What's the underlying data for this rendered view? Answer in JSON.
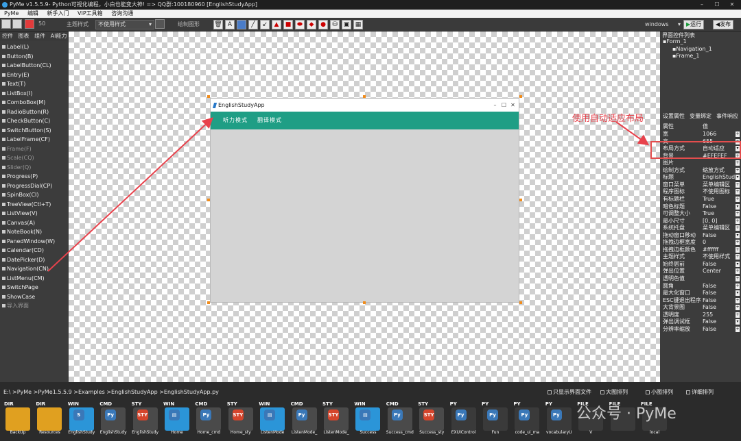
{
  "window": {
    "title": "PyMe v1.5.5.9- Python可视化编程，小白也能变大神!  => QQ群:100180960   [EnglishStudyApp]"
  },
  "menu": [
    "PyMe",
    "编辑",
    "新手入门",
    "VIP工具箱",
    "咨询沟通"
  ],
  "toolbar": {
    "zoom": "50",
    "theme_label": "主题样式",
    "theme_value": "不使用样式",
    "draw_label": "绘制图形",
    "platform": "windows",
    "run_label": "运行",
    "publish_label": "发布"
  },
  "left_tabs": [
    "控件",
    "图表",
    "组件",
    "AI能力"
  ],
  "widgets": [
    {
      "label": "Label(L)",
      "dim": false
    },
    {
      "label": "Button(B)",
      "dim": false
    },
    {
      "label": "LabelButton(CL)",
      "dim": false
    },
    {
      "label": "Entry(E)",
      "dim": false
    },
    {
      "label": "Text(T)",
      "dim": false
    },
    {
      "label": "ListBox(I)",
      "dim": false
    },
    {
      "label": "ComboBox(M)",
      "dim": false
    },
    {
      "label": "RadioButton(R)",
      "dim": false
    },
    {
      "label": "CheckButton(C)",
      "dim": false
    },
    {
      "label": "SwitchButton(S)",
      "dim": false
    },
    {
      "label": "LabelFrame(CF)",
      "dim": false
    },
    {
      "label": "Frame(F)",
      "dim": true
    },
    {
      "label": "Scale(CQ)",
      "dim": true
    },
    {
      "label": "Slider(Q)",
      "dim": true
    },
    {
      "label": "Progress(P)",
      "dim": false
    },
    {
      "label": "ProgressDial(CP)",
      "dim": false
    },
    {
      "label": "SpinBox(CI)",
      "dim": false
    },
    {
      "label": "TreeView(Ctl+T)",
      "dim": false
    },
    {
      "label": "ListView(V)",
      "dim": false
    },
    {
      "label": "Canvas(A)",
      "dim": false
    },
    {
      "label": "NoteBook(N)",
      "dim": false
    },
    {
      "label": "PanedWindow(W)",
      "dim": false
    },
    {
      "label": "Calendar(CD)",
      "dim": false
    },
    {
      "label": "DatePicker(D)",
      "dim": false
    },
    {
      "label": "Navigation(CN)",
      "dim": false
    },
    {
      "label": "ListMenu(CM)",
      "dim": false
    },
    {
      "label": "SwitchPage",
      "dim": false
    },
    {
      "label": "ShowCase",
      "dim": false
    },
    {
      "label": "导入界面",
      "dim": true
    }
  ],
  "form": {
    "title": "EnglishStudyApp",
    "minimize": "–",
    "maximize": "☐",
    "close": "✕",
    "nav_items": [
      "听力模式",
      "翻译模式"
    ],
    "nav_color": "#1f9e85"
  },
  "right_panel": {
    "tree_title": "界面控件列表",
    "tree": [
      {
        "label": "Form_1",
        "level": 0
      },
      {
        "label": "Navigation_1",
        "level": 1
      },
      {
        "label": "Frame_1",
        "level": 1
      }
    ],
    "tabs": [
      "设置属性",
      "变量绑定",
      "事件响应"
    ],
    "prop_header": {
      "name": "属性",
      "value": "值"
    },
    "props": [
      {
        "name": "宽",
        "value": "1066"
      },
      {
        "name": "高",
        "value": "655"
      },
      {
        "name": "布局方式",
        "value": "自动适应"
      },
      {
        "name": "背景",
        "value": "#EFEFEF"
      },
      {
        "name": "图片",
        "value": ""
      },
      {
        "name": "绘制方式",
        "value": "缩放方式"
      },
      {
        "name": "标题",
        "value": "EnglishStud"
      },
      {
        "name": "窗口菜单",
        "value": "菜单编辑区"
      },
      {
        "name": "程序图标",
        "value": "不使用图标"
      },
      {
        "name": "有标题栏",
        "value": "True"
      },
      {
        "name": "暗色标题",
        "value": "False"
      },
      {
        "name": "可调整大小",
        "value": "True"
      },
      {
        "name": "最小尺寸",
        "value": "[0, 0]"
      },
      {
        "name": "系统托盘",
        "value": "菜单编辑区"
      },
      {
        "name": "拖动窗口移动",
        "value": "False"
      },
      {
        "name": "拖拽边框宽度",
        "value": "0"
      },
      {
        "name": "拖拽边框颜色",
        "value": "#ffffff"
      },
      {
        "name": "主题样式",
        "value": "不使用样式"
      },
      {
        "name": "始终居前",
        "value": "False"
      },
      {
        "name": "弹出位置",
        "value": "Center"
      },
      {
        "name": "透明色值",
        "value": ""
      },
      {
        "name": "圆角",
        "value": "False"
      },
      {
        "name": "最大化窗口",
        "value": "False"
      },
      {
        "name": "ESC键退出程序",
        "value": "False"
      },
      {
        "name": "大背景图",
        "value": "False"
      },
      {
        "name": "透明度",
        "value": "255"
      },
      {
        "name": "弹出调试框",
        "value": "False"
      },
      {
        "name": "分辨率缩放",
        "value": "False"
      }
    ]
  },
  "annotation": {
    "text": "使用自动适应布局",
    "color": "#e8424c"
  },
  "path": "E:\\ >PyMe >PyMe1.5.5.9 >Examples >EnglishStudyApp >EnglishStudyApp.py",
  "view_options": [
    "只显示界面文件",
    "大图排列",
    "小图排列",
    "详细排列"
  ],
  "files": [
    {
      "type": "DIR",
      "name": "BackUp",
      "color": "#e0a020",
      "glyph": ""
    },
    {
      "type": "DIR",
      "name": "Resources",
      "color": "#e0a020",
      "glyph": ""
    },
    {
      "type": "WIN",
      "name": "EnglishStudy",
      "color": "#2b95d8",
      "glyph": "S"
    },
    {
      "type": "CMD",
      "name": "EnglishStudy",
      "color": "#4a4a4a",
      "glyph": "Py"
    },
    {
      "type": "STY",
      "name": "EnglishStudy",
      "color": "#4a4a4a",
      "glyph": "STY"
    },
    {
      "type": "WIN",
      "name": "Home",
      "color": "#2b95d8",
      "glyph": "▤"
    },
    {
      "type": "CMD",
      "name": "Home_cmd",
      "color": "#4a4a4a",
      "glyph": "Py"
    },
    {
      "type": "STY",
      "name": "Home_sty",
      "color": "#4a4a4a",
      "glyph": "STY"
    },
    {
      "type": "WIN",
      "name": "ListenMode",
      "color": "#2b95d8",
      "glyph": "▤"
    },
    {
      "type": "CMD",
      "name": "ListenMode_",
      "color": "#4a4a4a",
      "glyph": "Py"
    },
    {
      "type": "STY",
      "name": "ListenMode_",
      "color": "#4a4a4a",
      "glyph": "STY"
    },
    {
      "type": "WIN",
      "name": "Success",
      "color": "#2b95d8",
      "glyph": "▤"
    },
    {
      "type": "CMD",
      "name": "Success_cmd",
      "color": "#4a4a4a",
      "glyph": "Py"
    },
    {
      "type": "STY",
      "name": "Success_sty",
      "color": "#4a4a4a",
      "glyph": "STY"
    },
    {
      "type": "PY",
      "name": "EXUIControl",
      "color": "#3a3a3a",
      "glyph": "Py"
    },
    {
      "type": "PY",
      "name": "Fun",
      "color": "#3a3a3a",
      "glyph": "Py"
    },
    {
      "type": "PY",
      "name": "code_ui_ma",
      "color": "#3a3a3a",
      "glyph": "Py"
    },
    {
      "type": "PY",
      "name": "vocabularyU",
      "color": "#3a3a3a",
      "glyph": "Py"
    },
    {
      "type": "FILE",
      "name": "V",
      "color": "#3a3a3a",
      "glyph": ""
    },
    {
      "type": "FILE",
      "name": "",
      "color": "#3a3a3a",
      "glyph": ""
    },
    {
      "type": "FILE",
      "name": "local",
      "color": "#3a3a3a",
      "glyph": ""
    }
  ],
  "watermark": "公众号 · PyMe"
}
